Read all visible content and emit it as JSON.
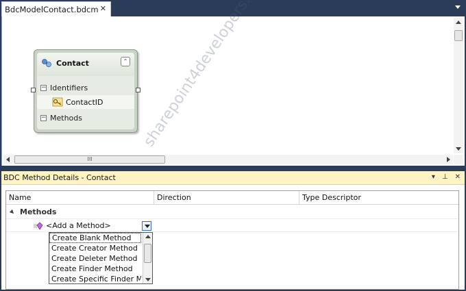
{
  "document_tab": {
    "title": "BdcModelContact.bdcm",
    "close_glyph": "✕"
  },
  "entity": {
    "name": "Contact",
    "collapse_glyph": "⌃",
    "identifiers_label": "Identifiers",
    "identifier_field": "ContactID",
    "methods_label": "Methods",
    "expander_glyph": "−"
  },
  "designer": {
    "hscroll_grip": "III"
  },
  "watermark": "sharepoint4developers.net",
  "tool_window": {
    "title": "BDC Method Details - Contact",
    "buttons": [
      "▾",
      "⊥",
      "✕"
    ],
    "columns": [
      "Name",
      "Direction",
      "Type Descriptor"
    ],
    "group_label": "Methods",
    "add_method_label": "<Add a Method>",
    "dropdown_options": [
      "Create Blank Method",
      "Create Creator Method",
      "Create Deleter Method",
      "Create Finder Method",
      "Create Specific Finder Method"
    ]
  },
  "colors": {
    "ide_background": "#2b3c59",
    "tool_header": "#fdf3c4",
    "entity_fill": "#e6ebe3"
  }
}
